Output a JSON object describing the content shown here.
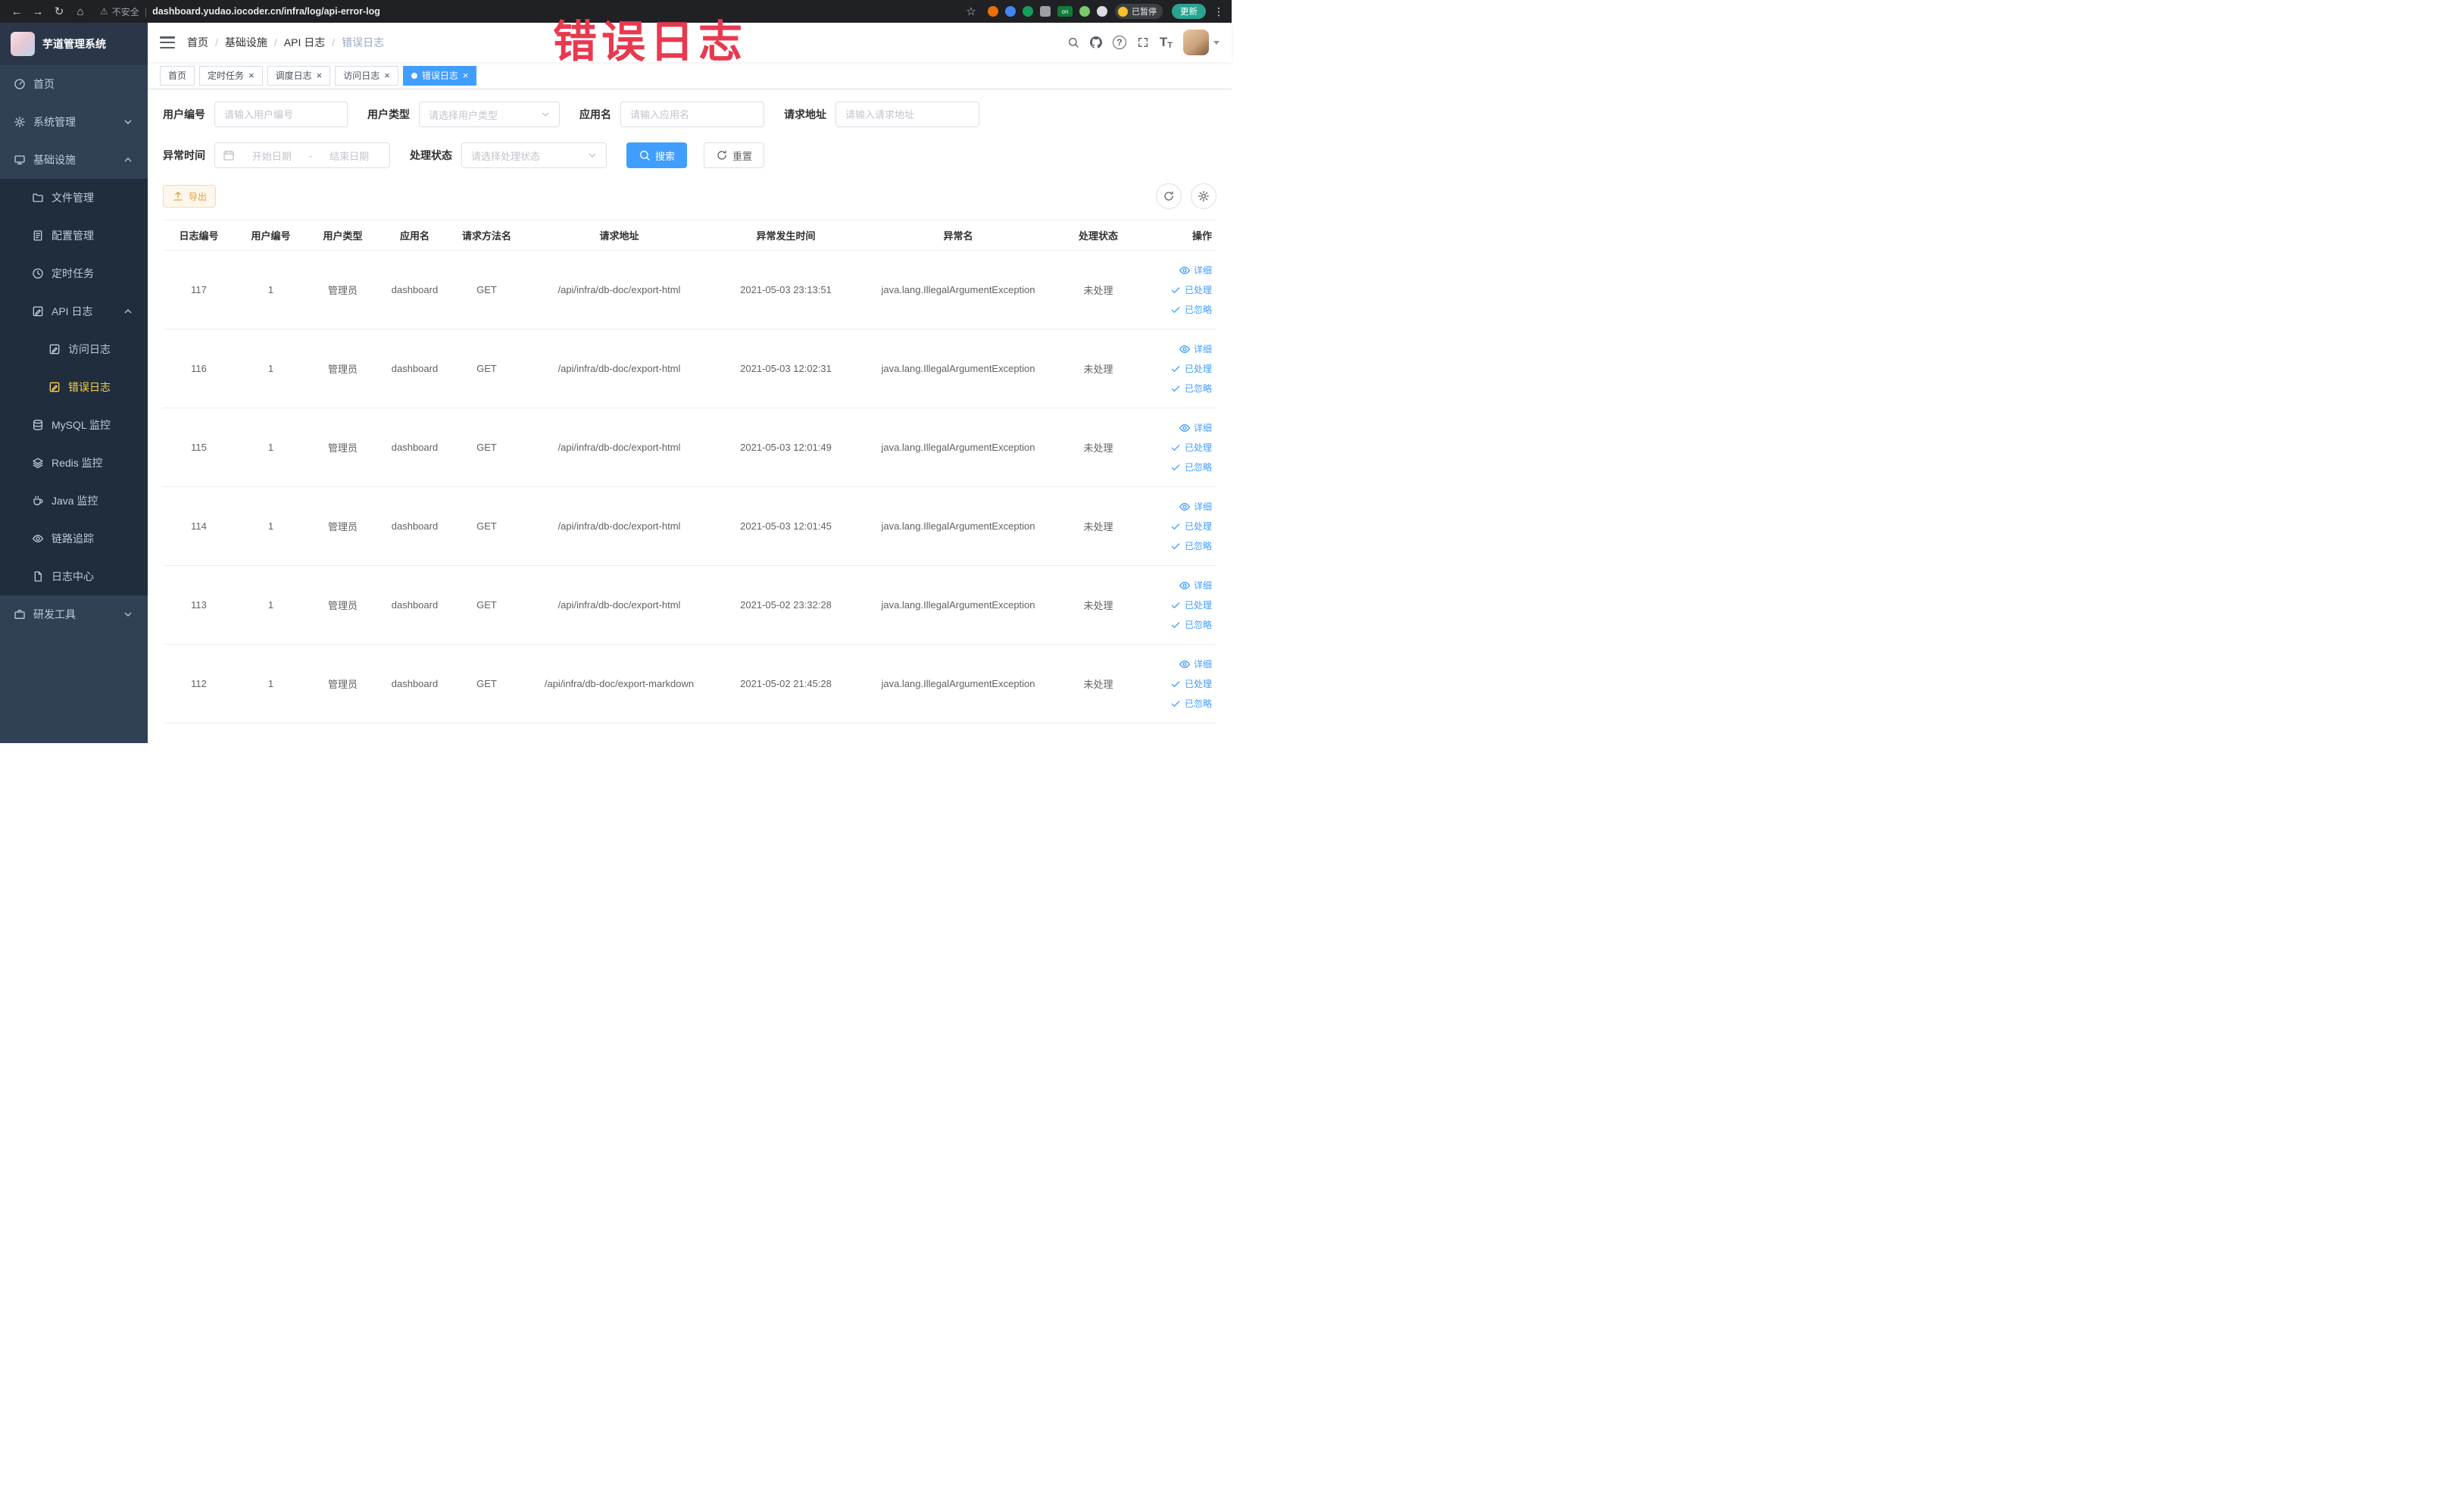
{
  "colors": {
    "accent": "#409eff",
    "sidebar_bg": "#304156",
    "submenu_bg": "#1f2d3d",
    "active_menu_text": "#ffd04b",
    "active_tab_bg": "#409eff",
    "export_warning": "#e6a23c",
    "watermark_red": "#e8394f",
    "chrome_bg": "#202124"
  },
  "icons": {
    "back": "←",
    "forward": "→",
    "reload": "↻",
    "home": "⌂",
    "warning": "⚠",
    "star": "☆",
    "kebab": "⋮",
    "close": "×",
    "question": "?",
    "text_size": "T"
  },
  "browser": {
    "security_text": "不安全",
    "url": "dashboard.yudao.iocoder.cn/infra/log/api-error-log",
    "extension_on_badge": "on",
    "paused_badge": "已暂停",
    "update_button": "更新"
  },
  "watermark_text": "错误日志",
  "sidebar": {
    "logo_title": "芋道管理系统",
    "items": {
      "home": "首页",
      "system": "系统管理",
      "infra": "基础设施",
      "file": "文件管理",
      "config": "配置管理",
      "job": "定时任务",
      "api_log": "API 日志",
      "access_log": "访问日志",
      "error_log": "错误日志",
      "mysql": "MySQL 监控",
      "redis": "Redis 监控",
      "java": "Java 监控",
      "trace": "链路追踪",
      "log_center": "日志中心",
      "devtools": "研发工具"
    }
  },
  "navbar": {
    "breadcrumb": [
      "首页",
      "基础设施",
      "API 日志",
      "错误日志"
    ],
    "separator": "/"
  },
  "tabs": [
    {
      "label": "首页"
    },
    {
      "label": "定时任务"
    },
    {
      "label": "调度日志"
    },
    {
      "label": "访问日志"
    },
    {
      "label": "错误日志"
    }
  ],
  "filters": {
    "user_id": {
      "label": "用户编号",
      "placeholder": "请输入用户编号"
    },
    "user_type": {
      "label": "用户类型",
      "placeholder": "请选择用户类型"
    },
    "app_name": {
      "label": "应用名",
      "placeholder": "请输入应用名"
    },
    "request_url": {
      "label": "请求地址",
      "placeholder": "请输入请求地址"
    },
    "exception_time": {
      "label": "异常时间",
      "start_placeholder": "开始日期",
      "separator": "-",
      "end_placeholder": "结束日期"
    },
    "status": {
      "label": "处理状态",
      "placeholder": "请选择处理状态"
    },
    "search_button": "搜索",
    "reset_button": "重置"
  },
  "toolbar": {
    "export_button": "导出"
  },
  "table": {
    "columns": [
      "日志编号",
      "用户编号",
      "用户类型",
      "应用名",
      "请求方法名",
      "请求地址",
      "异常发生时间",
      "异常名",
      "处理状态",
      "操作"
    ],
    "action_detail": "详细",
    "action_processed": "已处理",
    "action_ignored": "已忽略",
    "rows": [
      {
        "log_id": "117",
        "user_id": "1",
        "user_type": "管理员",
        "app_name": "dashboard",
        "method": "GET",
        "url": "/api/infra/db-doc/export-html",
        "time": "2021-05-03 23:13:51",
        "exception": "java.lang.IllegalArgumentException",
        "status": "未处理"
      },
      {
        "log_id": "116",
        "user_id": "1",
        "user_type": "管理员",
        "app_name": "dashboard",
        "method": "GET",
        "url": "/api/infra/db-doc/export-html",
        "time": "2021-05-03 12:02:31",
        "exception": "java.lang.IllegalArgumentException",
        "status": "未处理"
      },
      {
        "log_id": "115",
        "user_id": "1",
        "user_type": "管理员",
        "app_name": "dashboard",
        "method": "GET",
        "url": "/api/infra/db-doc/export-html",
        "time": "2021-05-03 12:01:49",
        "exception": "java.lang.IllegalArgumentException",
        "status": "未处理"
      },
      {
        "log_id": "114",
        "user_id": "1",
        "user_type": "管理员",
        "app_name": "dashboard",
        "method": "GET",
        "url": "/api/infra/db-doc/export-html",
        "time": "2021-05-03 12:01:45",
        "exception": "java.lang.IllegalArgumentException",
        "status": "未处理"
      },
      {
        "log_id": "113",
        "user_id": "1",
        "user_type": "管理员",
        "app_name": "dashboard",
        "method": "GET",
        "url": "/api/infra/db-doc/export-html",
        "time": "2021-05-02 23:32:28",
        "exception": "java.lang.IllegalArgumentException",
        "status": "未处理"
      },
      {
        "log_id": "112",
        "user_id": "1",
        "user_type": "管理员",
        "app_name": "dashboard",
        "method": "GET",
        "url": "/api/infra/db-doc/export-markdown",
        "time": "2021-05-02 21:45:28",
        "exception": "java.lang.IllegalArgumentException",
        "status": "未处理"
      }
    ]
  }
}
